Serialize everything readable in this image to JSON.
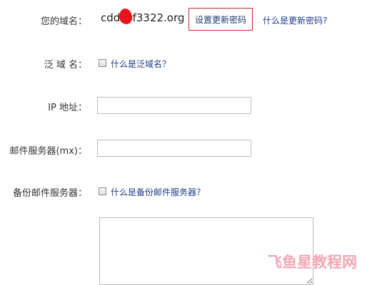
{
  "domain": {
    "label": "您的域名：",
    "value": "cddf",
    "value_suffix": "f3322.org",
    "set_password_button": "设置更新密码",
    "what_is_password_link": "什么是更新密码?"
  },
  "wildcard": {
    "label": "泛 域 名：",
    "link": "什么是泛域名？"
  },
  "ip": {
    "label": "IP  地址：",
    "value": ""
  },
  "mx": {
    "label": "邮件服务器(mx)：",
    "value": ""
  },
  "backup_mx": {
    "label": "备份邮件服务器：",
    "link": "什么是备份邮件服务器？"
  },
  "watermark": {
    "text": "飞鱼星教程网"
  }
}
